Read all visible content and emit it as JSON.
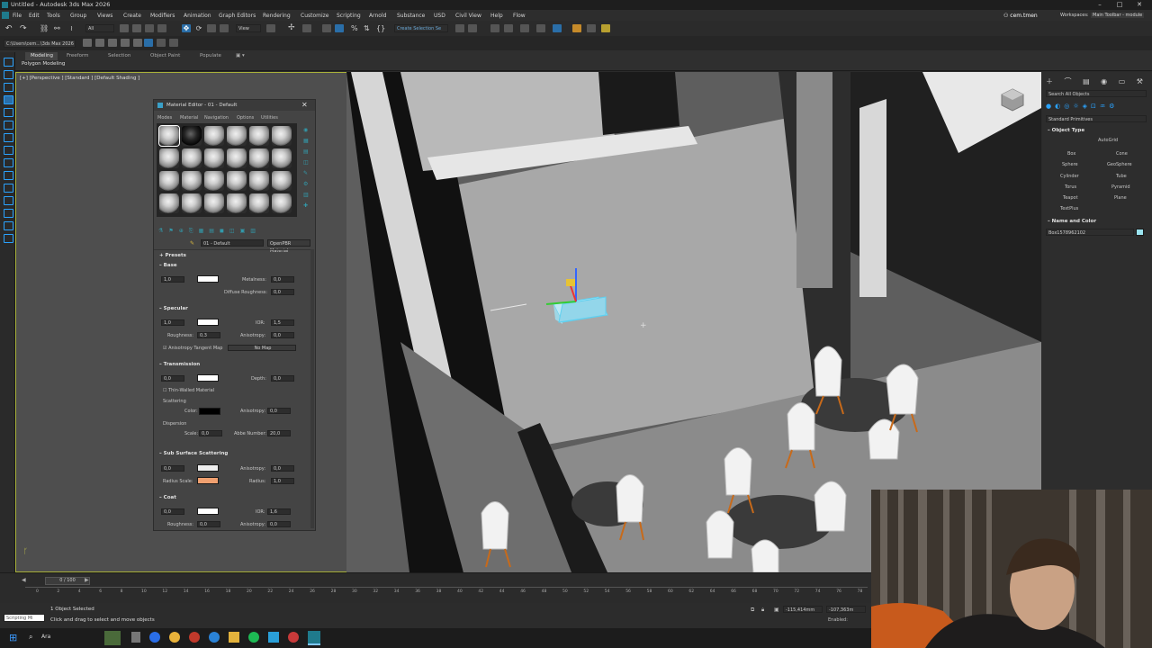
{
  "window": {
    "title": "Untitled - Autodesk 3ds Max 2026"
  },
  "menu": [
    "File",
    "Edit",
    "Tools",
    "Group",
    "Views",
    "Create",
    "Modifiers",
    "Animation",
    "Graph Editors",
    "Rendering",
    "Customize",
    "Scripting",
    "Arnold",
    "Substance",
    "USD",
    "Civil View",
    "Help",
    "Flow"
  ],
  "account": {
    "user": "cem.tmen",
    "workspace_label": "Workspaces:",
    "workspace_value": "Main Toolbar - module"
  },
  "toolbar": {
    "selection_filter": "All",
    "view_dropdown": "View",
    "selection_set": "Create Selection Se"
  },
  "project_path": "C:\\Users\\cem...\\3ds Max 2026",
  "ribbon": {
    "tabs": [
      "Modeling",
      "Freeform",
      "Selection",
      "Object Paint",
      "Populate"
    ],
    "panel_label": "Polygon Modeling"
  },
  "viewport": {
    "label": "[+] [Perspective ] [Standard ] [Default Shading ]"
  },
  "material_editor": {
    "title": "Material Editor - 01 - Default",
    "menu": [
      "Modes",
      "Material",
      "Navigation",
      "Options",
      "Utilities"
    ],
    "material_name": "01 - Default",
    "material_type": "OpenPBR Material",
    "sections": {
      "presets": "Presets",
      "base": "Base",
      "specular": "Specular",
      "transmission": "Transmission",
      "sss": "Sub Surface Scattering",
      "coat": "Coat"
    },
    "base": {
      "weight": "1,0",
      "metalness_label": "Metalness:",
      "metalness": "0,0",
      "diffuse_roughness_label": "Diffuse Roughness:",
      "diffuse_roughness": "0,0"
    },
    "specular": {
      "weight": "1,0",
      "ior_label": "IOR:",
      "ior": "1,5",
      "roughness_label": "Roughness:",
      "roughness": "0,3",
      "anisotropy_label": "Anisotropy:",
      "anisotropy": "0,0",
      "tangent_map_label": "Anisotropy Tangent Map",
      "tangent_map_value": "No Map"
    },
    "transmission": {
      "weight": "0,0",
      "depth_label": "Depth:",
      "depth": "0,0",
      "thin_walled": "Thin-Walled Material",
      "scattering": "Scattering",
      "color_label": "Color:",
      "anisotropy_label": "Anisotropy:",
      "anisotropy": "0,0",
      "dispersion": "Dispersion",
      "scale_label": "Scale:",
      "scale": "0,0",
      "abbe_label": "Abbe Number:",
      "abbe": "20,0"
    },
    "sss": {
      "weight": "0,0",
      "anisotropy_label": "Anisotropy:",
      "anisotropy": "0,0",
      "radius_scale_label": "Radius Scale:",
      "radius_label": "Radius:",
      "radius": "1,0"
    },
    "coat": {
      "weight": "0,0",
      "ior_label": "IOR:",
      "ior": "1,6",
      "roughness_label": "Roughness:",
      "roughness": "0,0",
      "anisotropy_label": "Anisotropy:",
      "anisotropy": "0,0"
    }
  },
  "command_panel": {
    "search_placeholder": "Search All Objects",
    "category": "Standard Primitives",
    "object_type_title": "Object Type",
    "autogrid": "AutoGrid",
    "buttons": [
      "Box",
      "Cone",
      "Sphere",
      "GeoSphere",
      "Cylinder",
      "Tube",
      "Torus",
      "Pyramid",
      "Teapot",
      "Plane",
      "TextPlus"
    ],
    "name_color_title": "Name and Color",
    "object_name": "Box1578962102"
  },
  "timeline": {
    "frame": "0 / 100",
    "ticks": [
      "0",
      "2",
      "4",
      "6",
      "8",
      "10",
      "12",
      "14",
      "16",
      "18",
      "20",
      "22",
      "24",
      "26",
      "28",
      "30",
      "32",
      "34",
      "36",
      "38",
      "40",
      "42",
      "44",
      "46",
      "48",
      "50",
      "52",
      "54",
      "56",
      "58",
      "60",
      "62",
      "64",
      "66",
      "68",
      "70",
      "72",
      "74",
      "76",
      "78"
    ]
  },
  "status": {
    "script_label": "Scripting Mi",
    "selected": "1 Object Selected",
    "hint": "Click and drag to select and move objects",
    "coord_x": "-115,414mm",
    "coord_y": "-107,363m",
    "enabled": "Enabled:"
  },
  "taskbar": {
    "search": "Ara"
  },
  "colors": {
    "accent": "#2aa3ff",
    "viewport_border": "#a9b13a",
    "sss_color": "#f0a070"
  }
}
